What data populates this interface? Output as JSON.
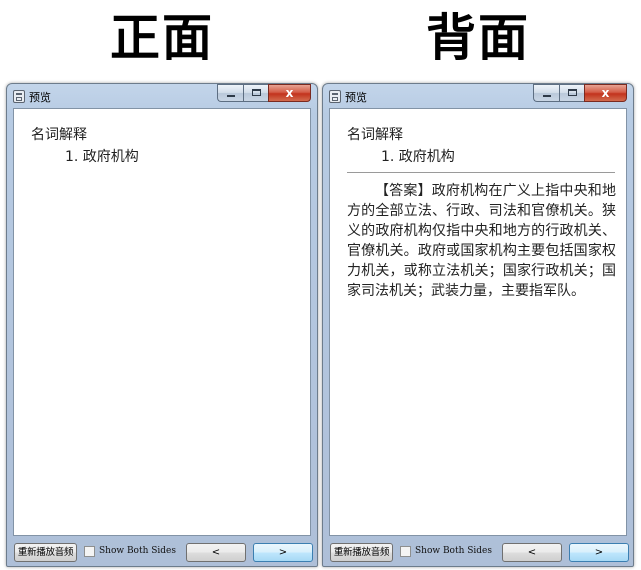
{
  "headings": {
    "front": "正面",
    "back": "背面"
  },
  "window": {
    "title": "预览",
    "close_glyph": "x"
  },
  "card": {
    "title": "名词解释",
    "item": "1. 政府机构",
    "answer": "【答案】政府机构在广义上指中央和地方的全部立法、行政、司法和官僚机关。狭义的政府机构仅指中央和地方的行政机关、官僚机关。政府或国家机构主要包括国家权力机关，或称立法机关；国家行政机关；国家司法机关；武装力量，主要指军队。"
  },
  "controls": {
    "replay_label": "重新播放音频",
    "show_both_label": "Show Both Sides",
    "prev_label": "<",
    "next_label": ">"
  },
  "icons": {
    "app": "card-preview-icon",
    "minimize": "minimize-icon",
    "maximize": "maximize-icon",
    "close": "close-icon"
  },
  "colors": {
    "close_button": "#c2331d",
    "next_button_border": "#3c7fb1"
  }
}
